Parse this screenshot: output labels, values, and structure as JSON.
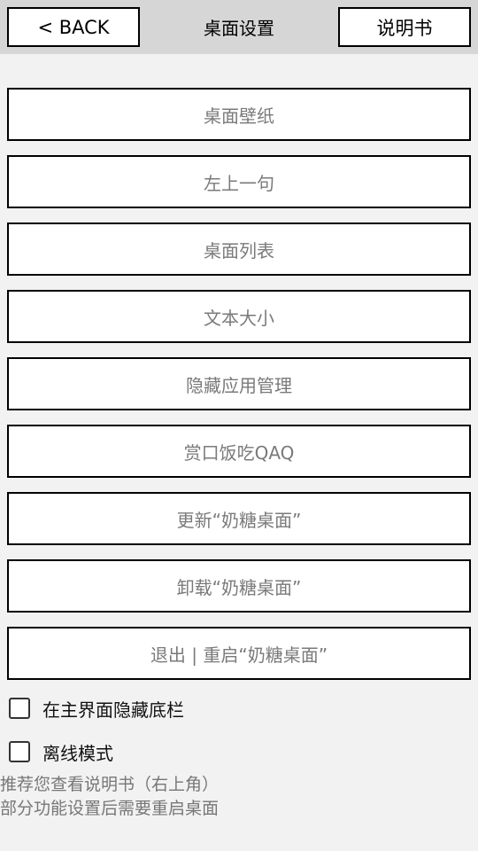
{
  "header": {
    "back_label": "< BACK",
    "title": "桌面设置",
    "manual_label": "说明书"
  },
  "menu": {
    "items": [
      "桌面壁纸",
      "左上一句",
      "桌面列表",
      "文本大小",
      "隐藏应用管理",
      "赏口饭吃QAQ",
      "更新“奶糖桌面”",
      "卸载“奶糖桌面”",
      "退出 | 重启“奶糖桌面”"
    ]
  },
  "options": {
    "hide_bottom_bar": "在主界面隐藏底栏",
    "offline_mode": "离线模式"
  },
  "notes": {
    "line1": "推荐您查看说明书（右上角）",
    "line2": "部分功能设置后需要重启桌面"
  }
}
